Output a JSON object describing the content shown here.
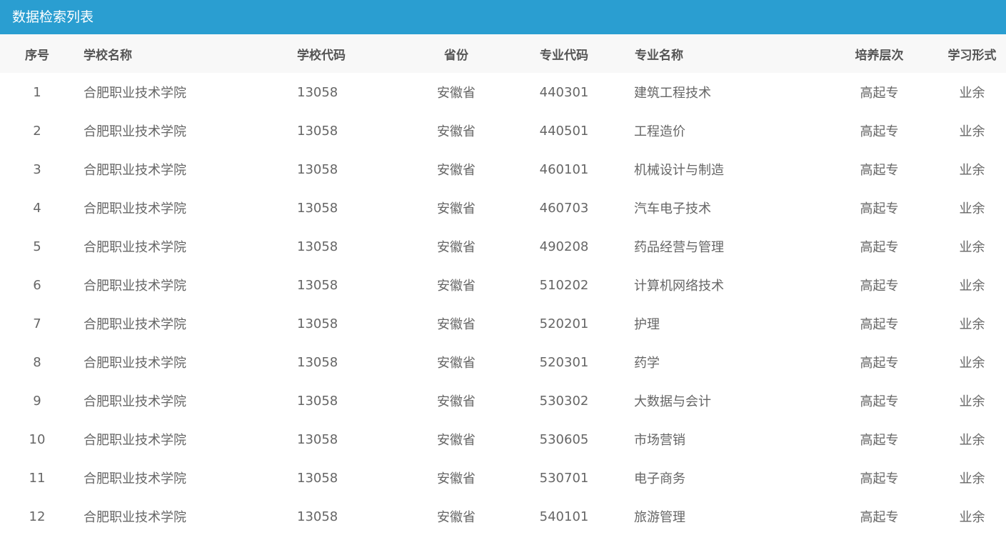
{
  "header": {
    "title": "数据检索列表"
  },
  "table": {
    "columns": [
      "序号",
      "学校名称",
      "学校代码",
      "省份",
      "专业代码",
      "专业名称",
      "培养层次",
      "学习形式"
    ],
    "rows": [
      [
        "1",
        "合肥职业技术学院",
        "13058",
        "安徽省",
        "440301",
        "建筑工程技术",
        "高起专",
        "业余"
      ],
      [
        "2",
        "合肥职业技术学院",
        "13058",
        "安徽省",
        "440501",
        "工程造价",
        "高起专",
        "业余"
      ],
      [
        "3",
        "合肥职业技术学院",
        "13058",
        "安徽省",
        "460101",
        "机械设计与制造",
        "高起专",
        "业余"
      ],
      [
        "4",
        "合肥职业技术学院",
        "13058",
        "安徽省",
        "460703",
        "汽车电子技术",
        "高起专",
        "业余"
      ],
      [
        "5",
        "合肥职业技术学院",
        "13058",
        "安徽省",
        "490208",
        "药品经营与管理",
        "高起专",
        "业余"
      ],
      [
        "6",
        "合肥职业技术学院",
        "13058",
        "安徽省",
        "510202",
        "计算机网络技术",
        "高起专",
        "业余"
      ],
      [
        "7",
        "合肥职业技术学院",
        "13058",
        "安徽省",
        "520201",
        "护理",
        "高起专",
        "业余"
      ],
      [
        "8",
        "合肥职业技术学院",
        "13058",
        "安徽省",
        "520301",
        "药学",
        "高起专",
        "业余"
      ],
      [
        "9",
        "合肥职业技术学院",
        "13058",
        "安徽省",
        "530302",
        "大数据与会计",
        "高起专",
        "业余"
      ],
      [
        "10",
        "合肥职业技术学院",
        "13058",
        "安徽省",
        "530605",
        "市场营销",
        "高起专",
        "业余"
      ],
      [
        "11",
        "合肥职业技术学院",
        "13058",
        "安徽省",
        "530701",
        "电子商务",
        "高起专",
        "业余"
      ],
      [
        "12",
        "合肥职业技术学院",
        "13058",
        "安徽省",
        "540101",
        "旅游管理",
        "高起专",
        "业余"
      ]
    ]
  },
  "colors": {
    "header_bg": "#2a9ed1",
    "table_head_bg": "#f8f8f8",
    "text": "#666666"
  }
}
